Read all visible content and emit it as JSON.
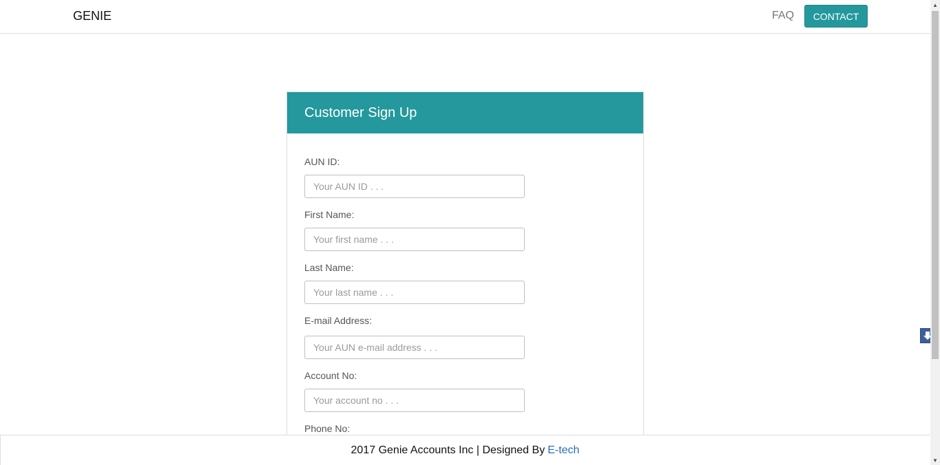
{
  "navbar": {
    "brand": "GENIE",
    "faq_label": "FAQ",
    "contact_label": "CONTACT"
  },
  "form": {
    "title": "Customer Sign Up",
    "fields": [
      {
        "label": "AUN ID:",
        "placeholder": "Your AUN ID . . ."
      },
      {
        "label": "First Name:",
        "placeholder": "Your first name . . ."
      },
      {
        "label": "Last Name:",
        "placeholder": "Your last name . . ."
      },
      {
        "label": "E-mail Address:",
        "placeholder": "Your AUN e-mail address . . ."
      },
      {
        "label": "Account No:",
        "placeholder": "Your account no . . ."
      },
      {
        "label": "Phone No:",
        "placeholder": ""
      }
    ]
  },
  "footer": {
    "text": "2017 Genie Accounts Inc | Designed By",
    "link_label": "E-tech"
  },
  "colors": {
    "accent": "#24989c",
    "link": "#2a6ebb",
    "scroll_button": "#3d5f9b"
  },
  "icons": {
    "scroll_down": "arrow-down-icon"
  }
}
